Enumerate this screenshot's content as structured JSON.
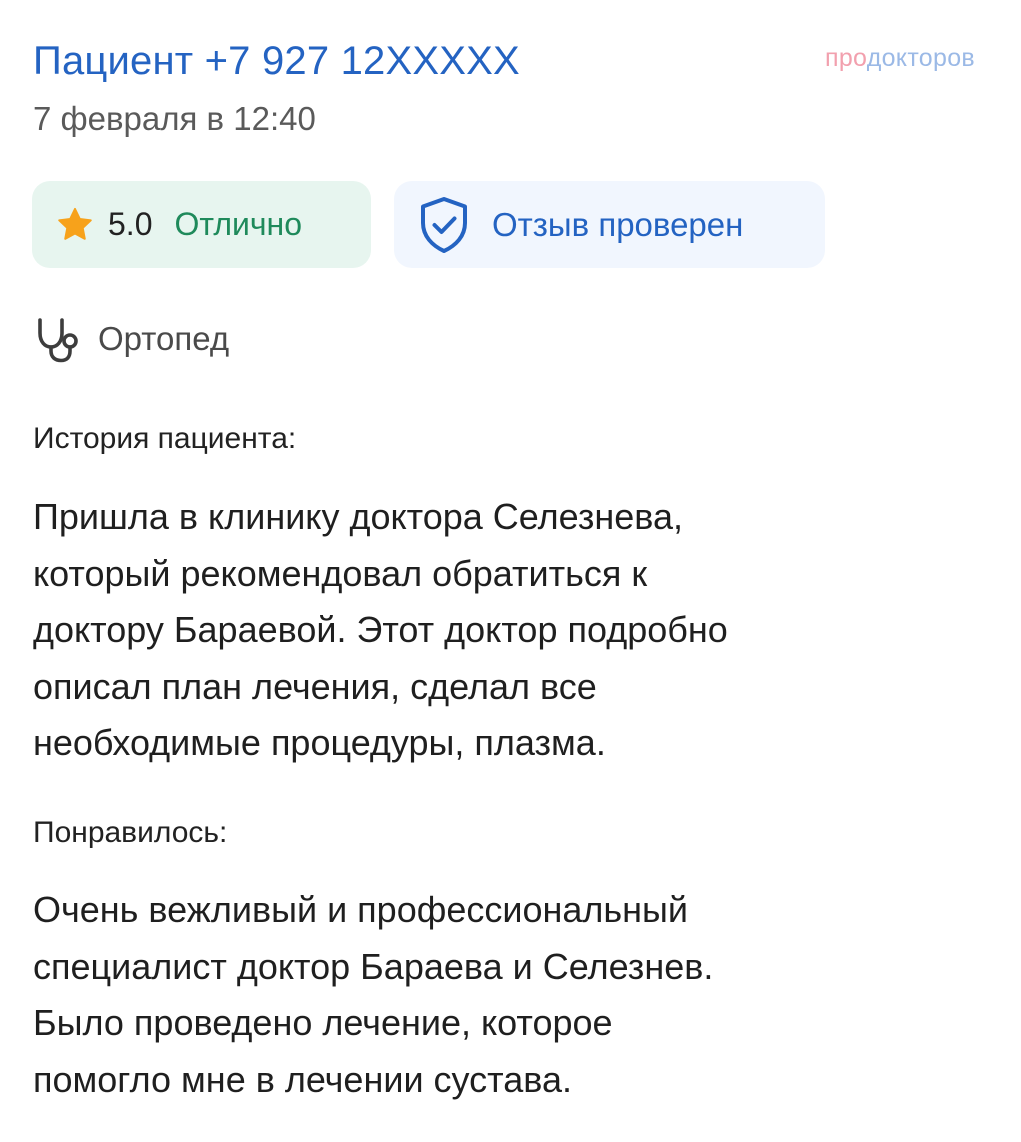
{
  "review": {
    "author": "Пациент +7 927 12XXXXX",
    "date": "7 февраля в 12:40",
    "brand": {
      "part1": "про",
      "part2": "докторов"
    },
    "rating": {
      "icon": "star-icon",
      "score": "5.0",
      "grade": "Отлично",
      "color": "#f7a21b"
    },
    "verified": {
      "icon": "shield-check-icon",
      "label": "Отзыв проверен"
    },
    "specialty": {
      "icon": "stethoscope-icon",
      "label": "Ортопед"
    },
    "history": {
      "title": "История пациента:",
      "lines": [
        "Пришла в клинику доктора Селезнева,",
        "который рекомендовал обратиться к",
        "доктору Бараевой. Этот доктор подробно",
        "описал план лечения, сделал все",
        "необходимые процедуры, плазма."
      ]
    },
    "liked": {
      "title": "Понравилось:",
      "lines": [
        "Очень вежливый и профессиональный",
        "специалист доктор Бараева и Селезнев.",
        "Было проведено лечение, которое",
        "помогло мне в лечении сустава."
      ]
    }
  },
  "colors": {
    "link_blue": "#2463c2",
    "green_text": "#1f8a5b",
    "green_chip_bg": "#e7f5ef",
    "blue_chip_bg": "#f1f6fe",
    "brand_pink": "#f2a0ae",
    "brand_blue": "#9bb9e6"
  }
}
